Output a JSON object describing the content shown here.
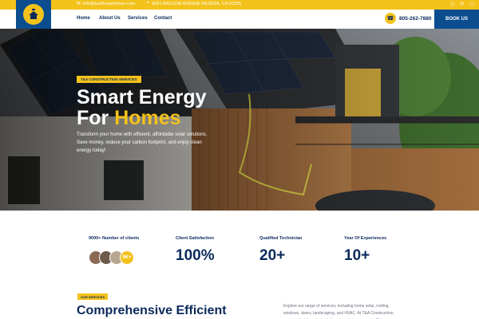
{
  "topbar": {
    "email": "info@tanflsolarhomes.com",
    "address": "8061 BALCOM AVENUE RESEDA, CA 91335",
    "social_icons": [
      "facebook-icon",
      "instagram-icon",
      "linkedin-icon"
    ]
  },
  "brand": {
    "logo_icon": "solar-house-logo",
    "primary_color": "#0b4d8f",
    "accent_color": "#f3c21b"
  },
  "nav": {
    "links": [
      "Home",
      "About Us",
      "Services",
      "Contact"
    ],
    "phone": "805-262-7880",
    "book_label": "BOOK US"
  },
  "hero": {
    "badge": "T&A CONSTRUCTION SERVICES",
    "title_line1": "Smart Energy",
    "title_line2_white": "For ",
    "title_line2_accent": "Homes",
    "subtitle": "Transform your home with efficient, affordable solar solutions. Save money, reduce your carbon footprint, and enjoy clean energy today!"
  },
  "stats": [
    {
      "label": "9000+ Number of clients",
      "value": "",
      "badge": "9K+"
    },
    {
      "label": "Client Satisfaction",
      "value": "100%"
    },
    {
      "label": "Qualified Technician",
      "value": "20+"
    },
    {
      "label": "Year Of Experiences",
      "value": "10+"
    }
  ],
  "services": {
    "badge": "OUR SERVICES",
    "title": "Comprehensive Efficient",
    "description": "Explore our range of services, including home solar, roofing, windows, doors, landscaping, and HVAC. At T&A Construction, we provide integrated solutions to enhance energy efficiency"
  }
}
